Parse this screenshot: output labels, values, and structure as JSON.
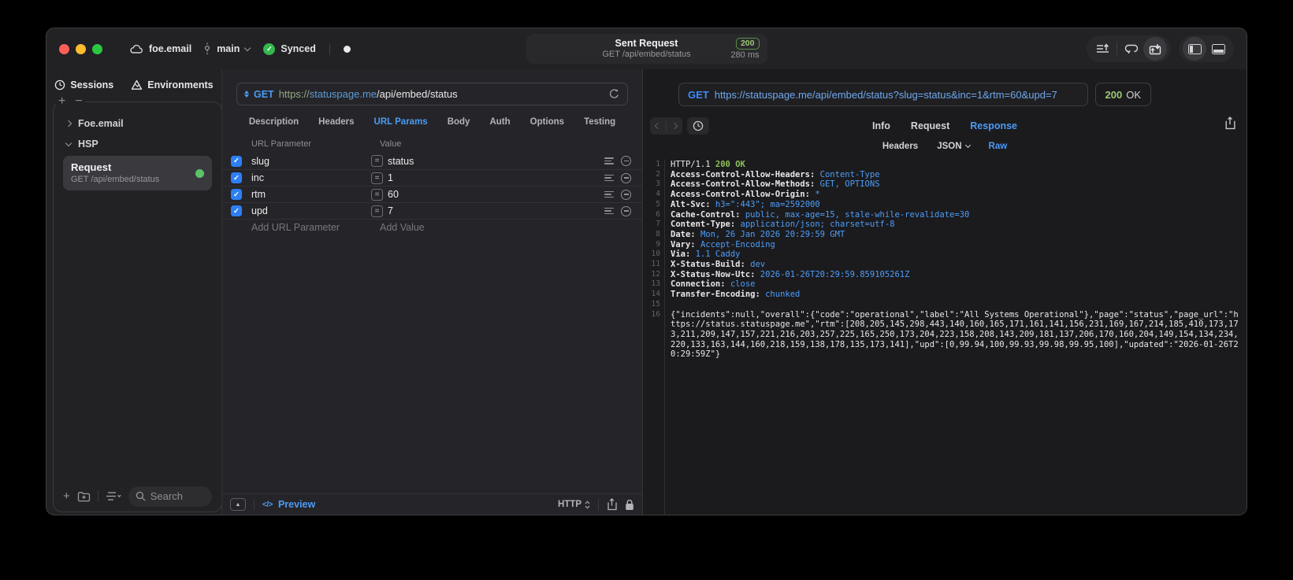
{
  "titlebar": {
    "project": "foe.email",
    "branch": "main",
    "synced_label": "Synced",
    "request_summary": {
      "title": "Sent Request",
      "method_path": "GET /api/embed/status",
      "status_code": "200",
      "duration": "280 ms"
    }
  },
  "sidebar": {
    "tabs": [
      {
        "label": "Sessions"
      },
      {
        "label": "Environments"
      }
    ],
    "groups": [
      {
        "label": "Foe.email"
      },
      {
        "label": "HSP"
      }
    ],
    "request_item": {
      "title": "Request",
      "subtitle": "GET /api/embed/status"
    },
    "search": {
      "placeholder": "Search"
    }
  },
  "request_editor": {
    "method": "GET",
    "url_scheme": "https://",
    "url_host": "statuspage.me",
    "url_path": "/api/embed/status",
    "tabs": [
      "Description",
      "Headers",
      "URL Params",
      "Body",
      "Auth",
      "Options",
      "Testing"
    ],
    "active_tab": "URL Params",
    "table": {
      "headers": [
        "URL Parameter",
        "Value"
      ],
      "rows": [
        {
          "enabled": true,
          "name": "slug",
          "value": "status"
        },
        {
          "enabled": true,
          "name": "inc",
          "value": "1"
        },
        {
          "enabled": true,
          "name": "rtm",
          "value": "60"
        },
        {
          "enabled": true,
          "name": "upd",
          "value": "7"
        }
      ],
      "add_name_placeholder": "Add URL Parameter",
      "add_value_placeholder": "Add Value"
    },
    "footer": {
      "preview_label": "Preview",
      "code_glyph": "</>",
      "protocol": "HTTP"
    }
  },
  "response_viewer": {
    "method": "GET",
    "url": "https://statuspage.me/api/embed/status?slug=status&inc=1&rtm=60&upd=7",
    "status_code": "200",
    "status_text": "OK",
    "tabs": [
      "Info",
      "Request",
      "Response"
    ],
    "active_tab": "Response",
    "subtabs": [
      "Headers",
      "JSON",
      "Raw"
    ],
    "active_subtab": "Raw",
    "lines": [
      {
        "n": "1",
        "segs": [
          [
            "HTTP/1.1 ",
            "w"
          ],
          [
            "200 OK",
            "g"
          ]
        ]
      },
      {
        "n": "2",
        "segs": [
          [
            "Access-Control-Allow-Headers: ",
            "k"
          ],
          [
            "Content-Type",
            "v"
          ]
        ]
      },
      {
        "n": "3",
        "segs": [
          [
            "Access-Control-Allow-Methods: ",
            "k"
          ],
          [
            "GET, OPTIONS",
            "v"
          ]
        ]
      },
      {
        "n": "4",
        "segs": [
          [
            "Access-Control-Allow-Origin: ",
            "k"
          ],
          [
            "*",
            "v"
          ]
        ]
      },
      {
        "n": "5",
        "segs": [
          [
            "Alt-Svc: ",
            "k"
          ],
          [
            "h3=\":443\"; ma=2592000",
            "v"
          ]
        ]
      },
      {
        "n": "6",
        "segs": [
          [
            "Cache-Control: ",
            "k"
          ],
          [
            "public, max-age=15, stale-while-revalidate=30",
            "v"
          ]
        ]
      },
      {
        "n": "7",
        "segs": [
          [
            "Content-Type: ",
            "k"
          ],
          [
            "application/json; charset=utf-8",
            "v"
          ]
        ]
      },
      {
        "n": "8",
        "segs": [
          [
            "Date: ",
            "k"
          ],
          [
            "Mon, 26 Jan 2026 20:29:59 GMT",
            "v"
          ]
        ]
      },
      {
        "n": "9",
        "segs": [
          [
            "Vary: ",
            "k"
          ],
          [
            "Accept-Encoding",
            "v"
          ]
        ]
      },
      {
        "n": "10",
        "segs": [
          [
            "Via: ",
            "k"
          ],
          [
            "1.1 Caddy",
            "v"
          ]
        ]
      },
      {
        "n": "11",
        "segs": [
          [
            "X-Status-Build: ",
            "k"
          ],
          [
            "dev",
            "v"
          ]
        ]
      },
      {
        "n": "12",
        "segs": [
          [
            "X-Status-Now-Utc: ",
            "k"
          ],
          [
            "2026-01-26T20:29:59.859105261Z",
            "v"
          ]
        ]
      },
      {
        "n": "13",
        "segs": [
          [
            "Connection: ",
            "k"
          ],
          [
            "close",
            "v"
          ]
        ]
      },
      {
        "n": "14",
        "segs": [
          [
            "Transfer-Encoding: ",
            "k"
          ],
          [
            "chunked",
            "v"
          ]
        ]
      },
      {
        "n": "15",
        "segs": []
      },
      {
        "n": "16",
        "segs": [
          [
            "{\"incidents\":null,\"overall\":{\"code\":\"operational\",\"label\":\"All Systems Operational\"},\"page\":\"status\",\"page_url\":\"https://status.statuspage.me\",\"rtm\":[208,205,145,298,443,140,160,165,171,161,141,156,231,169,167,214,185,410,173,173,211,209,147,157,221,216,203,257,225,165,250,173,204,223,158,208,143,209,181,137,206,170,160,204,149,154,134,234,220,133,163,144,160,218,159,138,178,135,173,141],\"upd\":[0,99.94,100,99.93,99.98,99.95,100],\"updated\":\"2026-01-26T20:29:59Z\"}",
            "w"
          ]
        ]
      }
    ]
  }
}
